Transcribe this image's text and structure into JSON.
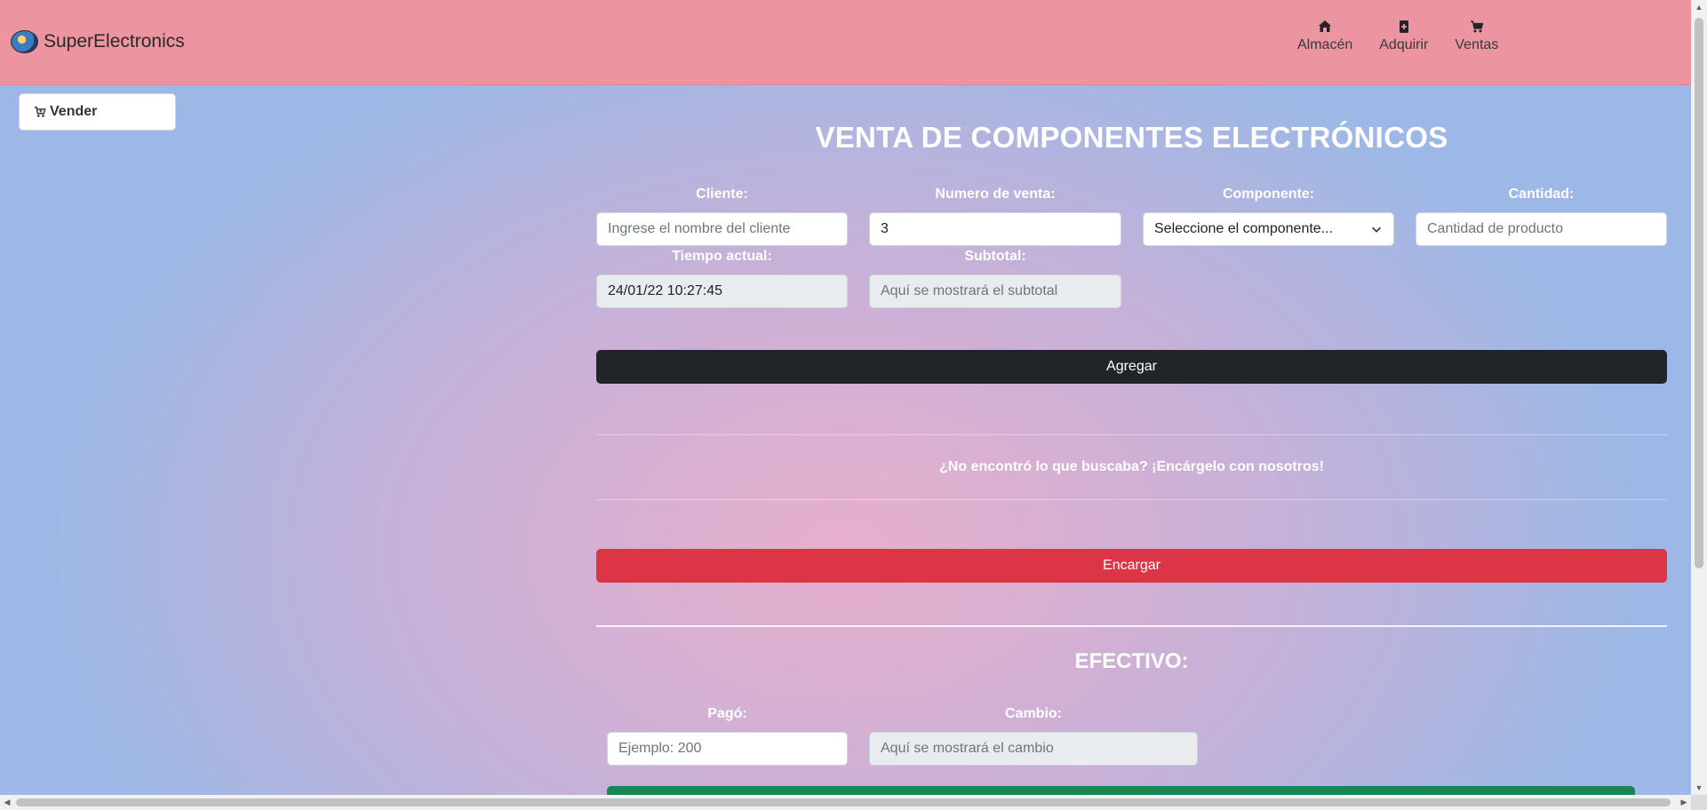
{
  "navbar": {
    "brand": "SuperElectronics",
    "links": {
      "almacen": "Almacén",
      "adquirir": "Adquirir",
      "ventas": "Ventas"
    }
  },
  "sidebar": {
    "vender_label": "Vender"
  },
  "form": {
    "title": "VENTA DE COMPONENTES ELECTRÓNICOS",
    "cliente": {
      "label": "Cliente:",
      "placeholder": "Ingrese el nombre del cliente",
      "value": ""
    },
    "numero_venta": {
      "label": "Numero de venta:",
      "value": "3"
    },
    "componente": {
      "label": "Componente:",
      "selected": "Seleccione el componente..."
    },
    "cantidad": {
      "label": "Cantidad:",
      "placeholder": "Cantidad de producto"
    },
    "tiempo": {
      "label": "Tiempo actual:",
      "value": "24/01/22 10:27:45"
    },
    "subtotal": {
      "label": "Subtotal:",
      "placeholder": "Aquí se mostrará el subtotal"
    },
    "agregar_label": "Agregar",
    "notice": "¿No encontró lo que buscaba? ¡Encárgelo con nosotros!",
    "encargar_label": "Encargar"
  },
  "efectivo": {
    "title": "EFECTIVO:",
    "pago": {
      "label": "Pagó:",
      "placeholder": "Ejemplo: 200"
    },
    "cambio": {
      "label": "Cambio:",
      "placeholder": "Aquí se mostrará el cambio"
    }
  },
  "colors": {
    "navbar": "#ec94a0",
    "dark_button": "#212529",
    "red_button": "#dc3545",
    "green_button": "#198754"
  }
}
